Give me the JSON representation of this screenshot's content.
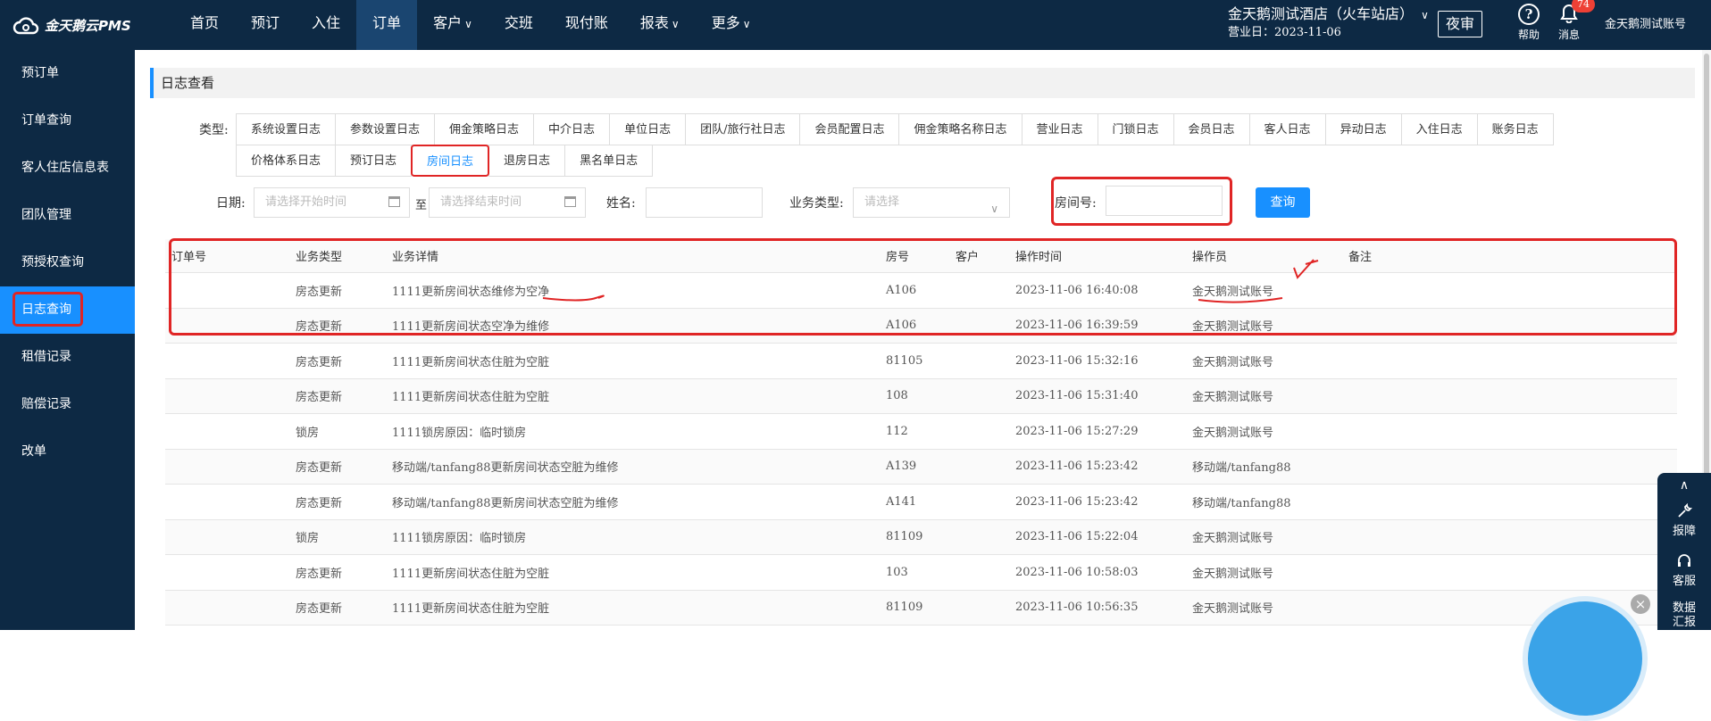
{
  "app": {
    "logo_text": "金天鹅云PMS"
  },
  "nav": {
    "items": [
      {
        "label": "首页",
        "dropdown": false,
        "active": false
      },
      {
        "label": "预订",
        "dropdown": false,
        "active": false
      },
      {
        "label": "入住",
        "dropdown": false,
        "active": false
      },
      {
        "label": "订单",
        "dropdown": false,
        "active": true
      },
      {
        "label": "客户",
        "dropdown": true,
        "active": false
      },
      {
        "label": "交班",
        "dropdown": false,
        "active": false
      },
      {
        "label": "现付账",
        "dropdown": false,
        "active": false
      },
      {
        "label": "报表",
        "dropdown": true,
        "active": false
      },
      {
        "label": "更多",
        "dropdown": true,
        "active": false
      }
    ]
  },
  "header": {
    "hotel_name": "金天鹅测试酒店（火车站店）",
    "business_date": "营业日：2023-11-06",
    "night_audit": "夜审",
    "help_label": "帮助",
    "message_label": "消息",
    "message_badge": "74",
    "account": "金天鹅测试账号"
  },
  "sidebar": {
    "items": [
      {
        "label": "预订单",
        "active": false
      },
      {
        "label": "订单查询",
        "active": false
      },
      {
        "label": "客人住店信息表",
        "active": false
      },
      {
        "label": "团队管理",
        "active": false
      },
      {
        "label": "预授权查询",
        "active": false
      },
      {
        "label": "日志查询",
        "active": true
      },
      {
        "label": "租借记录",
        "active": false
      },
      {
        "label": "赔偿记录",
        "active": false
      },
      {
        "label": "改单",
        "active": false
      }
    ]
  },
  "page": {
    "title": "日志查看"
  },
  "filters": {
    "type_label": "类型:",
    "tabs_row1": [
      "系统设置日志",
      "参数设置日志",
      "佣金策略日志",
      "中介日志",
      "单位日志",
      "团队/旅行社日志",
      "会员配置日志",
      "佣金策略名称日志",
      "营业日志",
      "门锁日志",
      "会员日志",
      "客人日志",
      "异动日志",
      "入住日志",
      "账务日志"
    ],
    "tabs_row2": [
      "价格体系日志",
      "预订日志",
      "房间日志",
      "退房日志",
      "黑名单日志"
    ],
    "active_tab": "房间日志",
    "date_label": "日期:",
    "start_placeholder": "请选择开始时间",
    "to_label": "至",
    "end_placeholder": "请选择结束时间",
    "name_label": "姓名:",
    "name_value": "",
    "biz_type_label": "业务类型:",
    "biz_type_placeholder": "请选择",
    "room_label": "房间号:",
    "room_value": "",
    "query_button": "查询"
  },
  "table": {
    "columns": [
      "订单号",
      "业务类型",
      "业务详情",
      "房号",
      "客户",
      "操作时间",
      "操作员",
      "备注"
    ],
    "rows": [
      {
        "order": "",
        "type": "房态更新",
        "detail": "1111更新房间状态维修为空净",
        "room": "A106",
        "customer": "",
        "time": "2023-11-06 16:40:08",
        "operator": "金天鹅测试账号",
        "note": ""
      },
      {
        "order": "",
        "type": "房态更新",
        "detail": "1111更新房间状态空净为维修",
        "room": "A106",
        "customer": "",
        "time": "2023-11-06 16:39:59",
        "operator": "金天鹅测试账号",
        "note": ""
      },
      {
        "order": "",
        "type": "房态更新",
        "detail": "1111更新房间状态住脏为空脏",
        "room": "81105",
        "customer": "",
        "time": "2023-11-06 15:32:16",
        "operator": "金天鹅测试账号",
        "note": ""
      },
      {
        "order": "",
        "type": "房态更新",
        "detail": "1111更新房间状态住脏为空脏",
        "room": "108",
        "customer": "",
        "time": "2023-11-06 15:31:40",
        "operator": "金天鹅测试账号",
        "note": ""
      },
      {
        "order": "",
        "type": "锁房",
        "detail": "1111锁房原因：临时锁房",
        "room": "112",
        "customer": "",
        "time": "2023-11-06 15:27:29",
        "operator": "金天鹅测试账号",
        "note": ""
      },
      {
        "order": "",
        "type": "房态更新",
        "detail": "移动端/tanfang88更新房间状态空脏为维修",
        "room": "A139",
        "customer": "",
        "time": "2023-11-06 15:23:42",
        "operator": "移动端/tanfang88",
        "note": ""
      },
      {
        "order": "",
        "type": "房态更新",
        "detail": "移动端/tanfang88更新房间状态空脏为维修",
        "room": "A141",
        "customer": "",
        "time": "2023-11-06 15:23:42",
        "operator": "移动端/tanfang88",
        "note": ""
      },
      {
        "order": "",
        "type": "锁房",
        "detail": "1111锁房原因：临时锁房",
        "room": "81109",
        "customer": "",
        "time": "2023-11-06 15:22:04",
        "operator": "金天鹅测试账号",
        "note": ""
      },
      {
        "order": "",
        "type": "房态更新",
        "detail": "1111更新房间状态住脏为空脏",
        "room": "103",
        "customer": "",
        "time": "2023-11-06 10:58:03",
        "operator": "金天鹅测试账号",
        "note": ""
      },
      {
        "order": "",
        "type": "房态更新",
        "detail": "1111更新房间状态住脏为空脏",
        "room": "81109",
        "customer": "",
        "time": "2023-11-06 10:56:35",
        "operator": "金天鹅测试账号",
        "note": ""
      }
    ]
  },
  "float_panel": {
    "items": [
      {
        "label": "报障",
        "icon": "wrench-icon"
      },
      {
        "label": "客服",
        "icon": "headset-icon"
      },
      {
        "label": "数据汇报",
        "icon": "chart-icon"
      }
    ]
  },
  "colors": {
    "topbar": "#0d2944",
    "accent": "#1890ff",
    "annotation": "#e02525"
  }
}
